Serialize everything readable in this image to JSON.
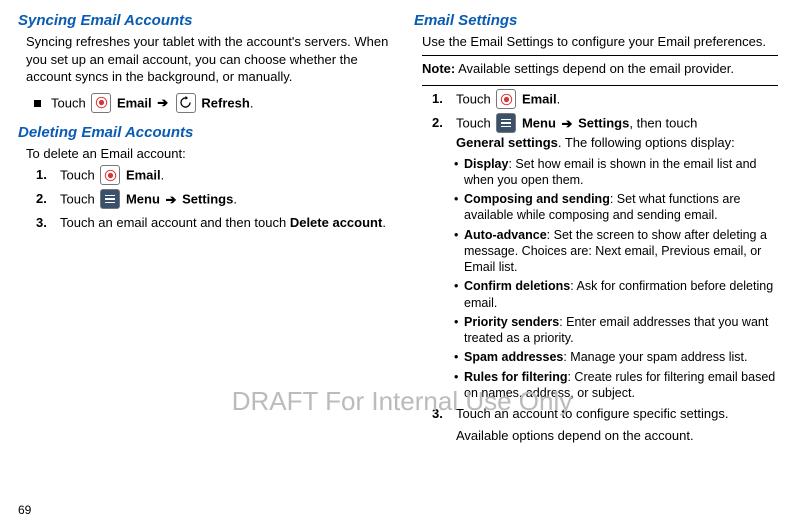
{
  "left": {
    "sync": {
      "heading": "Syncing Email Accounts",
      "para": "Syncing refreshes your tablet with the account's servers. When you set up an email account, you can choose whether the account syncs in the background, or manually.",
      "touch_prefix": "Touch",
      "email_label": "Email",
      "arrow": "➔",
      "refresh_label": "Refresh",
      "period": "."
    },
    "delete": {
      "heading": "Deleting Email Accounts",
      "intro": "To delete an Email account:",
      "step1_prefix": "Touch",
      "step1_label": "Email",
      "step2_prefix": "Touch",
      "step2_menu": "Menu",
      "step2_arrow": "➔",
      "step2_settings": "Settings",
      "step3_a": "Touch an email account and then touch ",
      "step3_b": "Delete account",
      "step3_c": "."
    }
  },
  "right": {
    "heading": "Email Settings",
    "intro": "Use the Email Settings to configure your Email preferences.",
    "note_label": "Note:",
    "note_text": " Available settings depend on the email provider.",
    "step1_prefix": "Touch",
    "step1_label": "Email",
    "step2_prefix": "Touch",
    "step2_menu": "Menu",
    "step2_arrow": "➔",
    "step2_settings": "Settings",
    "step2_then": ", then touch",
    "step2_general": "General settings",
    "step2_tail": ". The following options display:",
    "opts": [
      {
        "b": "Display",
        "t": ": Set how email is shown in the email list and when you open them."
      },
      {
        "b": "Composing and sending",
        "t": ": Set what functions are available while composing and sending email."
      },
      {
        "b": "Auto-advance",
        "t": ": Set the screen to show after deleting a message. Choices are: Next email, Previous email, or Email list."
      },
      {
        "b": "Confirm deletions",
        "t": ": Ask for confirmation before deleting email."
      },
      {
        "b": "Priority senders",
        "t": ": Enter email addresses that you want treated as a priority."
      },
      {
        "b": "Spam addresses",
        "t": ": Manage your spam address list."
      },
      {
        "b": "Rules for filtering",
        "t": ": Create rules for filtering email based on names, address, or subject."
      }
    ],
    "step3": "Touch an account to configure specific settings.",
    "step3_after": "Available options depend on the account."
  },
  "watermark": "DRAFT For Internal Use Only",
  "page_number": "69"
}
